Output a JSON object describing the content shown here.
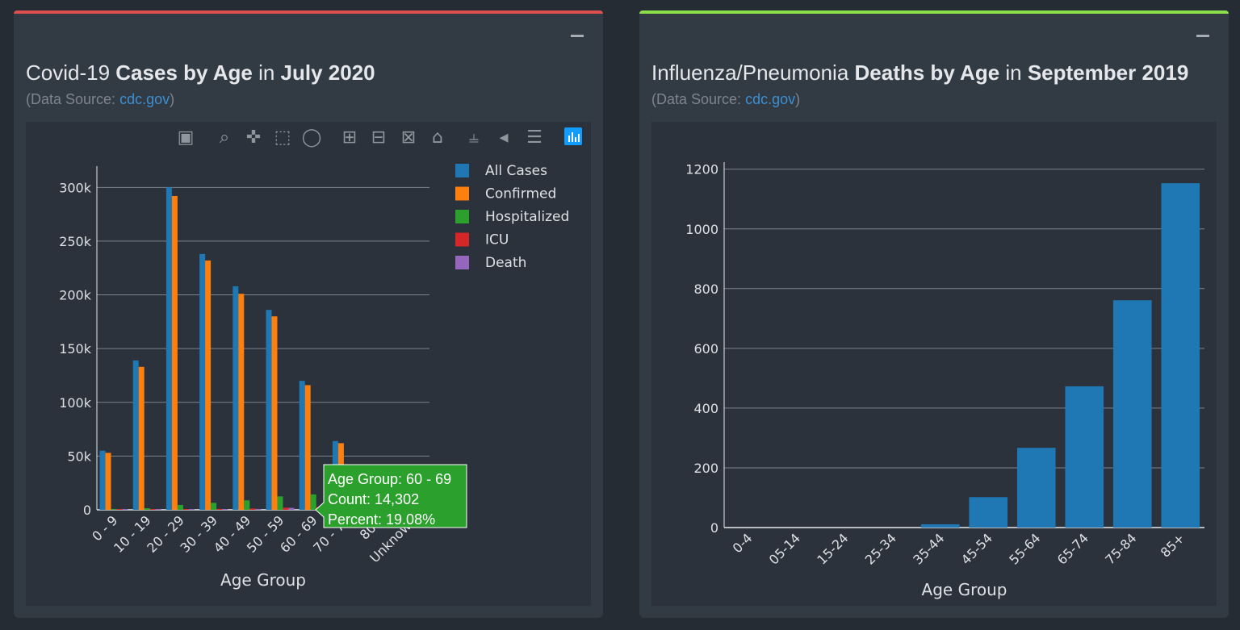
{
  "left_panel": {
    "accent": "#de4f4f",
    "title_pre": "Covid-19 ",
    "title_b1": "Cases by Age",
    "title_mid": " in ",
    "title_b2": "July 2020",
    "source_pre": "(Data Source: ",
    "source_link": "cdc.gov",
    "source_post": ")"
  },
  "right_panel": {
    "accent": "#8ee04a",
    "title_pre": "Influenza/Pneumonia ",
    "title_b1": "Deaths by Age",
    "title_mid": " in ",
    "title_b2": "September 2019",
    "source_pre": "(Data Source: ",
    "source_link": "cdc.gov",
    "source_post": ")"
  },
  "modebar": [
    "camera-icon",
    "zoom-icon",
    "pan-icon",
    "box-select-icon",
    "lasso-select-icon",
    "zoom-in-icon",
    "zoom-out-icon",
    "autoscale-icon",
    "reset-axes-icon",
    "spike-lines-icon",
    "hover-closest-icon",
    "hover-compare-icon",
    "plotly-logo-icon"
  ],
  "tooltip": {
    "line1": "Age Group: 60 - 69",
    "line2": "Count: 14,302",
    "line3": "Percent: 19.08%",
    "color": "#2ca02c"
  },
  "chart_data": [
    {
      "type": "bar",
      "xlabel": "Age Group",
      "ylabel": "",
      "ylim": [
        0,
        316000
      ],
      "yticks": [
        0,
        50000,
        100000,
        150000,
        200000,
        250000,
        300000
      ],
      "ytick_labels": [
        "0",
        "50k",
        "100k",
        "150k",
        "200k",
        "250k",
        "300k"
      ],
      "categories": [
        "0 - 9",
        "10 - 19",
        "20 - 29",
        "30 - 39",
        "40 - 49",
        "50 - 59",
        "60 - 69",
        "70 - 79",
        "80+",
        "Unknown"
      ],
      "legend_position": "top-right",
      "grid": true,
      "series": [
        {
          "name": "All Cases",
          "color": "#1f77b4",
          "values": [
            55000,
            139000,
            300000,
            238000,
            208000,
            186000,
            120000,
            64000,
            30000,
            4000
          ]
        },
        {
          "name": "Confirmed",
          "color": "#ff7f0e",
          "values": [
            53000,
            133000,
            292000,
            232000,
            201000,
            180000,
            116000,
            62000,
            29000,
            3800
          ]
        },
        {
          "name": "Hospitalized",
          "color": "#2ca02c",
          "values": [
            400,
            1500,
            4500,
            6500,
            8800,
            12500,
            14302,
            13500,
            11000,
            300
          ]
        },
        {
          "name": "ICU",
          "color": "#d62728",
          "values": [
            60,
            180,
            500,
            800,
            1200,
            2000,
            2500,
            2300,
            1600,
            40
          ]
        },
        {
          "name": "Death",
          "color": "#9467bd",
          "values": [
            10,
            30,
            150,
            350,
            800,
            1800,
            3500,
            5200,
            7800,
            40
          ]
        }
      ]
    },
    {
      "type": "bar",
      "xlabel": "Age Group",
      "ylabel": "",
      "ylim": [
        0,
        1210
      ],
      "yticks": [
        0,
        200,
        400,
        600,
        800,
        1000,
        1200
      ],
      "ytick_labels": [
        "0",
        "200",
        "400",
        "600",
        "800",
        "1000",
        "1200"
      ],
      "categories": [
        "0-4",
        "05-14",
        "15-24",
        "25-34",
        "35-44",
        "45-54",
        "55-64",
        "65-74",
        "75-84",
        "85+"
      ],
      "grid": true,
      "series": [
        {
          "color": "#1f77b4",
          "values": [
            0,
            0,
            0,
            0,
            11,
            102,
            267,
            473,
            761,
            1153
          ]
        }
      ]
    }
  ]
}
